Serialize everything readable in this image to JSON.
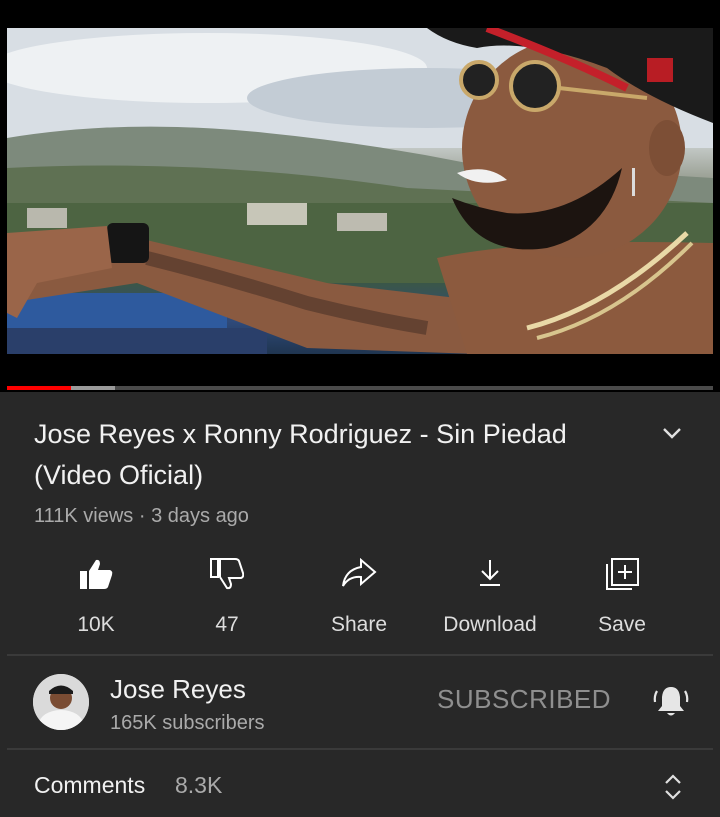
{
  "video": {
    "title": "Jose Reyes x Ronny Rodriguez - Sin Piedad (Video Oficial)",
    "views": "111K views",
    "age": "3 days ago",
    "meta_line": "111K views · 3 days ago",
    "progress_played": 0.09,
    "progress_buffered": 0.153
  },
  "actions": [
    {
      "icon": "thumbs-up-icon",
      "label": "10K"
    },
    {
      "icon": "thumbs-down-icon",
      "label": "47"
    },
    {
      "icon": "share-icon",
      "label": "Share"
    },
    {
      "icon": "download-icon",
      "label": "Download"
    },
    {
      "icon": "save-playlist-icon",
      "label": "Save"
    }
  ],
  "channel": {
    "name": "Jose Reyes",
    "subscribers": "165K subscribers",
    "subscribe_state": "SUBSCRIBED",
    "bell_icon": "notification-bell-icon"
  },
  "comments": {
    "label": "Comments",
    "count": "8.3K"
  },
  "colors": {
    "background": "#282828",
    "progress_played": "#ff0000",
    "secondary_text": "#aaaaaa"
  }
}
